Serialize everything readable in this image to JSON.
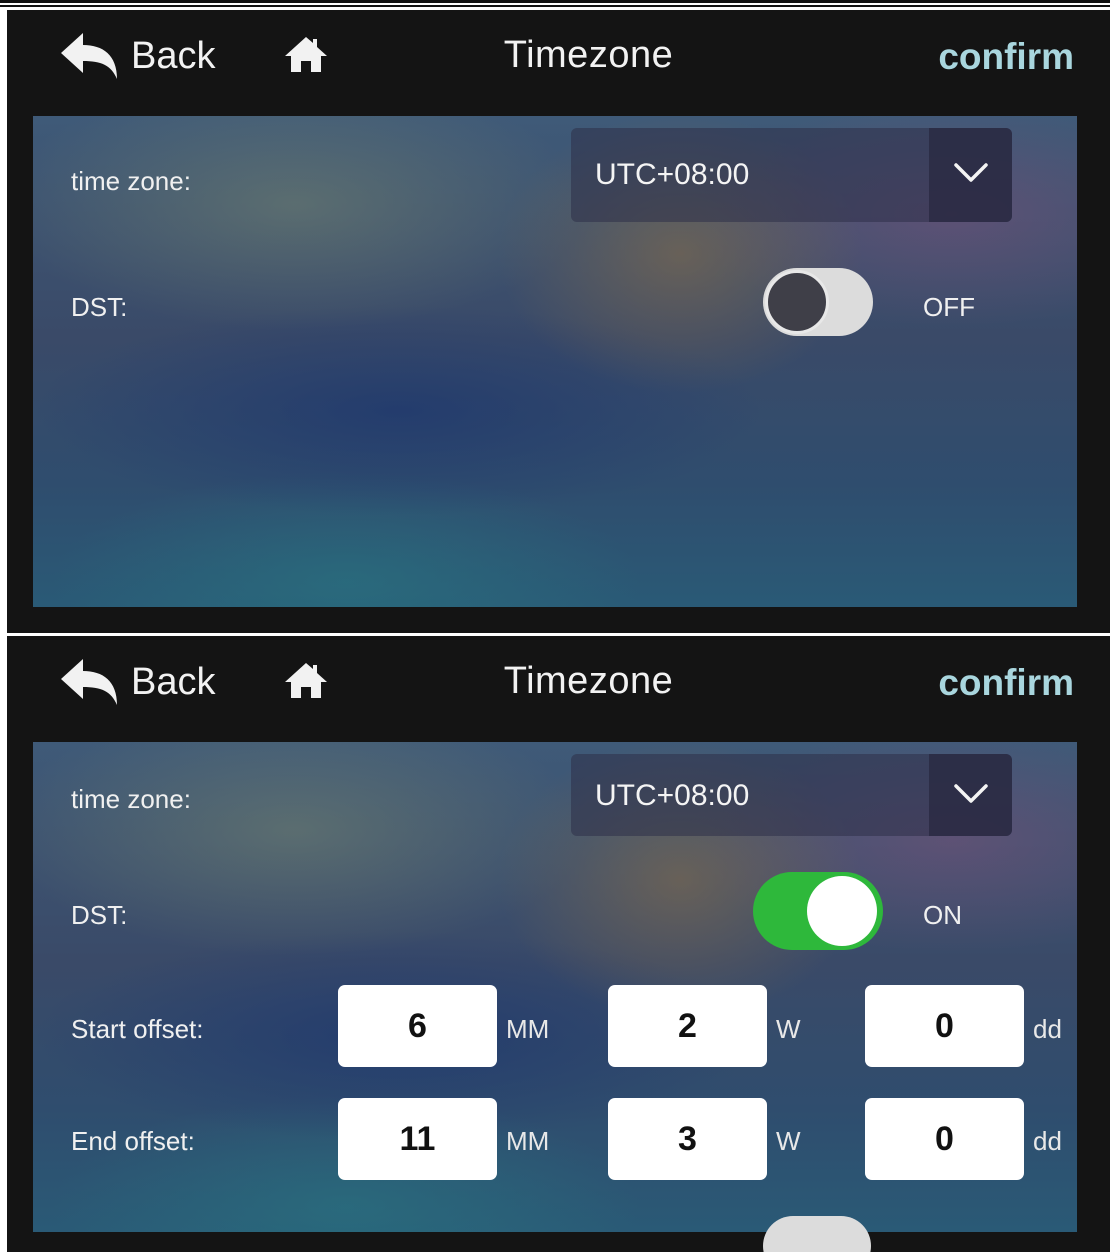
{
  "screens": [
    {
      "header": {
        "back_label": "Back",
        "title": "Timezone",
        "confirm_label": "confirm"
      },
      "timezone": {
        "label": "time zone:",
        "value": "UTC+08:00"
      },
      "dst": {
        "label": "DST:",
        "state": "OFF"
      }
    },
    {
      "header": {
        "back_label": "Back",
        "title": "Timezone",
        "confirm_label": "confirm"
      },
      "timezone": {
        "label": "time zone:",
        "value": "UTC+08:00"
      },
      "dst": {
        "label": "DST:",
        "state": "ON"
      },
      "start_offset": {
        "label": "Start offset:",
        "month": "6",
        "week": "2",
        "day": "0"
      },
      "end_offset": {
        "label": "End offset:",
        "month": "11",
        "week": "3",
        "day": "0"
      },
      "units": {
        "month": "MM",
        "week": "W",
        "day": "dd"
      }
    }
  ],
  "colors": {
    "confirm": "#a9d6de",
    "toggle_on": "#2eb83b",
    "toggle_off": "#dcdcdc",
    "header_bg": "#141414"
  },
  "icons": {
    "back": "back-arrow-icon",
    "home": "home-icon",
    "dropdown": "chevron-down-icon"
  }
}
